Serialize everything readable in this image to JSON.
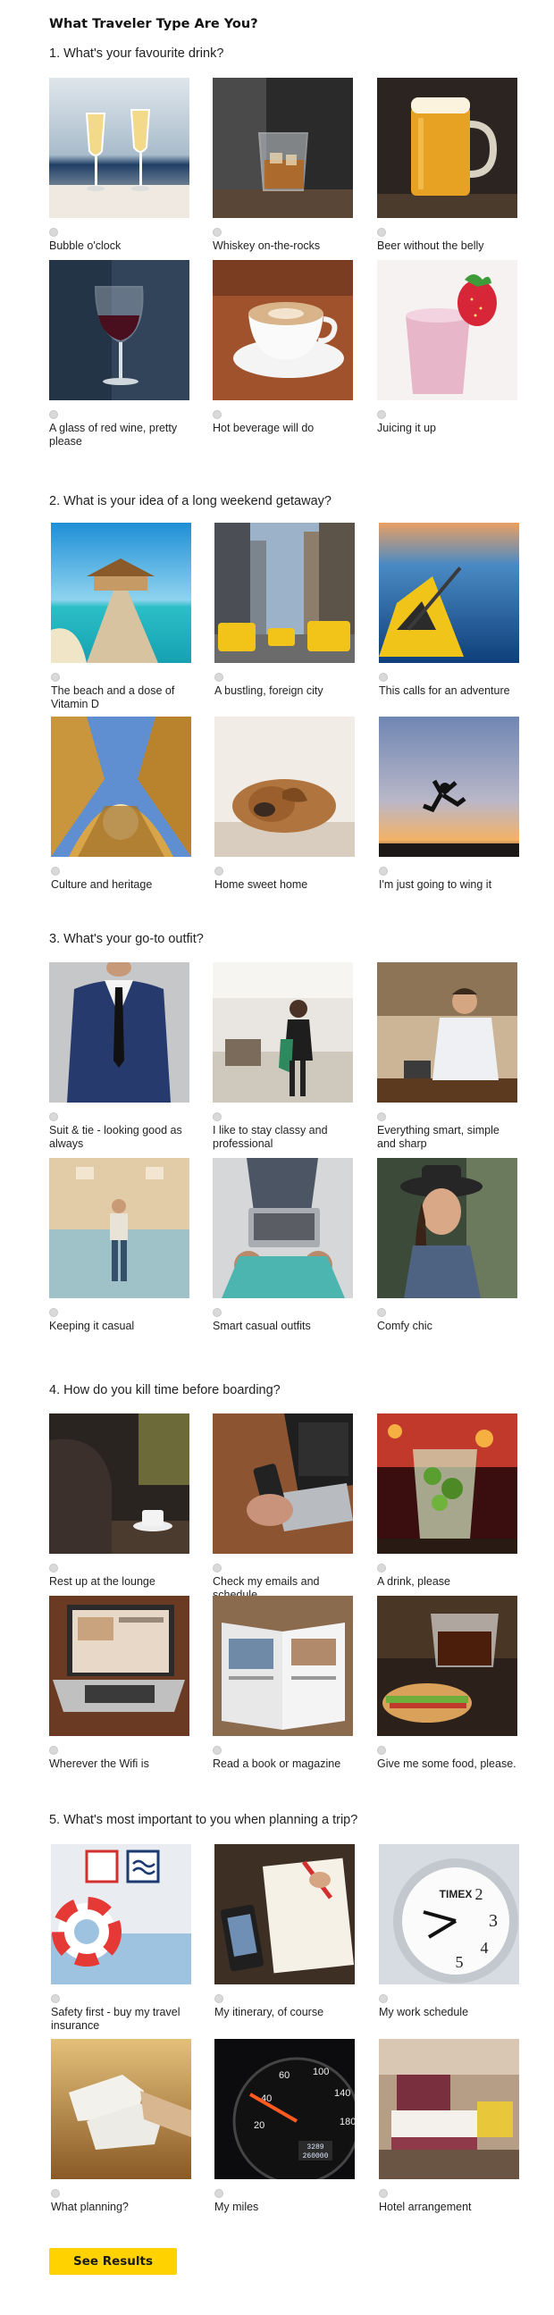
{
  "quiz_title": "What Traveler Type Are You?",
  "questions": [
    {
      "title": "1. What's your favourite drink?",
      "options": [
        {
          "label": "Bubble o'clock",
          "icon": "champagne-glasses"
        },
        {
          "label": "Whiskey on-the-rocks",
          "icon": "whiskey-glass"
        },
        {
          "label": "Beer without the belly",
          "icon": "beer-mug"
        },
        {
          "label": "A glass of red wine, pretty please",
          "icon": "wine-glass"
        },
        {
          "label": "Hot beverage will do",
          "icon": "coffee-cup"
        },
        {
          "label": "Juicing it up",
          "icon": "smoothie"
        }
      ]
    },
    {
      "title": "2. What is your idea of a long weekend getaway?",
      "options": [
        {
          "label": "The beach and a dose of Vitamin D",
          "icon": "beach-pier"
        },
        {
          "label": "A bustling, foreign city",
          "icon": "city-street"
        },
        {
          "label": "This calls for an adventure",
          "icon": "kayak"
        },
        {
          "label": "Culture and heritage",
          "icon": "dome"
        },
        {
          "label": "Home sweet home",
          "icon": "sleeping-dog"
        },
        {
          "label": "I'm just going to wing it",
          "icon": "jumping-person"
        }
      ]
    },
    {
      "title": "3. What's your go-to outfit?",
      "options": [
        {
          "label": "Suit & tie - looking good as always",
          "icon": "suit"
        },
        {
          "label": "I like to stay classy and professional",
          "icon": "office-woman"
        },
        {
          "label": "Everything smart, simple and sharp",
          "icon": "cafe-man"
        },
        {
          "label": "Keeping it casual",
          "icon": "casual-wall"
        },
        {
          "label": "Smart casual outfits",
          "icon": "laptop-lap"
        },
        {
          "label": "Comfy chic",
          "icon": "hat-woman"
        }
      ]
    },
    {
      "title": "4. How do you kill time before boarding?",
      "options": [
        {
          "label": "Rest up at the lounge",
          "icon": "lounge-coffee"
        },
        {
          "label": "Check my emails and schedule",
          "icon": "phone-laptop"
        },
        {
          "label": "A drink, please",
          "icon": "mojito"
        },
        {
          "label": "Wherever the Wifi is",
          "icon": "laptop"
        },
        {
          "label": "Read a book or magazine",
          "icon": "magazine"
        },
        {
          "label": "Give me some food, please.",
          "icon": "sandwich-coffee"
        }
      ]
    },
    {
      "title": "5. What's most important to you when planning a trip?",
      "options": [
        {
          "label": "Safety first - buy my travel insurance",
          "icon": "lifebuoy"
        },
        {
          "label": "My itinerary, of course",
          "icon": "notebook"
        },
        {
          "label": "My work schedule",
          "icon": "alarm-clock"
        },
        {
          "label": "What planning?",
          "icon": "sneakers"
        },
        {
          "label": "My miles",
          "icon": "speedometer"
        },
        {
          "label": "Hotel arrangement",
          "icon": "hotel-room"
        }
      ]
    }
  ],
  "clock_brand": "TIMEX",
  "odometer_top": "3289",
  "odometer_bottom": "260000",
  "results_button": "See Results",
  "colors": {
    "button": "#ffd200",
    "radio": "#d9d9d9"
  }
}
